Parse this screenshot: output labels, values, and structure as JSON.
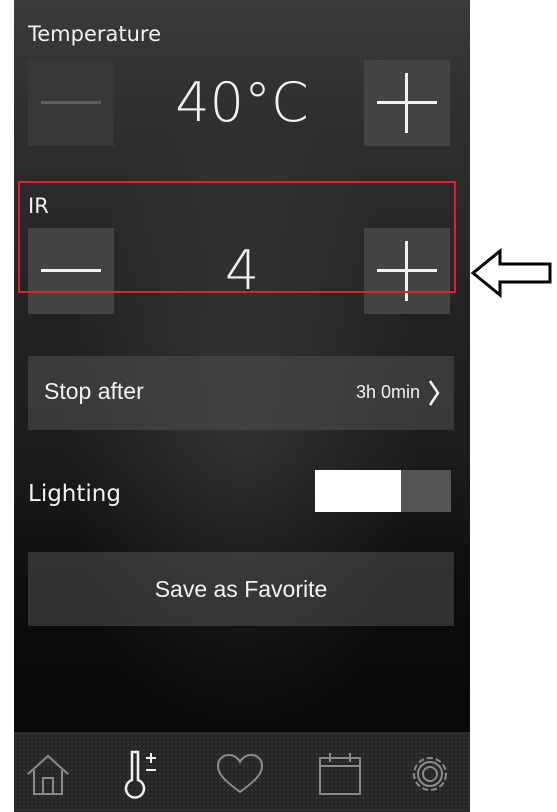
{
  "temperature": {
    "label": "Temperature",
    "value": "40°C",
    "decrement_icon": "minus-icon",
    "increment_icon": "plus-icon"
  },
  "ir": {
    "label": "IR",
    "value": "4",
    "decrement_icon": "minus-icon",
    "increment_icon": "plus-icon",
    "highlight_color": "#d9232b"
  },
  "stop_after": {
    "label": "Stop after",
    "value": "3h 0min",
    "icon": "chevron-right-icon"
  },
  "lighting": {
    "label": "Lighting",
    "state": "on"
  },
  "favorite": {
    "label": "Save as Favorite"
  },
  "tabbar": {
    "tabs": [
      {
        "icon": "home-icon"
      },
      {
        "icon": "thermometer-plus-icon"
      },
      {
        "icon": "heart-icon"
      },
      {
        "icon": "calendar-icon"
      },
      {
        "icon": "gear-icon"
      }
    ]
  },
  "annotation": {
    "icon": "left-arrow-icon"
  },
  "colors": {
    "accent": "#d9232b",
    "text": "#f2f2f2",
    "button": "#444444"
  }
}
